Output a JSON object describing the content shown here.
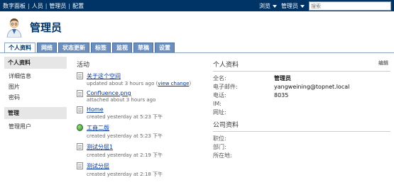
{
  "breadcrumb": [
    "数字面板",
    "人员",
    "管理员",
    "配置"
  ],
  "topnav": {
    "browse": "浏览",
    "user": "管理员",
    "search_placeholder": "搜索"
  },
  "page": {
    "title": "管理员"
  },
  "tabs": [
    "个人资料",
    "网络",
    "状态更新",
    "标签",
    "监视",
    "草稿",
    "设置"
  ],
  "sidebar": {
    "profile_header": "个人资料",
    "profile_links": [
      "详细信息",
      "图片",
      "密码"
    ],
    "admin_header": "管理",
    "admin_links": [
      "管理用户"
    ]
  },
  "activity": {
    "title": "活动",
    "items": [
      {
        "title": "关于这个空间",
        "sub": "updated about 3 hours ago",
        "link": "view change",
        "icon": "document-icon"
      },
      {
        "title": "Confluence.png",
        "sub": "attached about 3 hours ago",
        "icon": "document-icon"
      },
      {
        "title": "Home",
        "sub": "created yesterday at 5:23 下午",
        "icon": "document-icon"
      },
      {
        "title": "工商二版",
        "sub": "created yesterday at 5:23 下午",
        "icon": "globe-icon"
      },
      {
        "title": "测试分层1",
        "sub": "created yesterday at 2:19 下午",
        "icon": "document-icon"
      },
      {
        "title": "测试分层",
        "sub": "created yesterday at 2:18 下午",
        "icon": "document-icon"
      }
    ]
  },
  "profile": {
    "title": "个人资料",
    "edit": "编辑",
    "fields": [
      {
        "label": "全名:",
        "value": "管理员"
      },
      {
        "label": "电子邮件:",
        "value": "yangweining@topnet.local"
      },
      {
        "label": "电话:",
        "value": "8035"
      },
      {
        "label": "IM:",
        "value": ""
      },
      {
        "label": "网址:",
        "value": ""
      }
    ]
  },
  "company": {
    "title": "公司资料",
    "fields": [
      {
        "label": "职位:",
        "value": ""
      },
      {
        "label": "部门:",
        "value": ""
      },
      {
        "label": "所在地:",
        "value": ""
      }
    ]
  }
}
